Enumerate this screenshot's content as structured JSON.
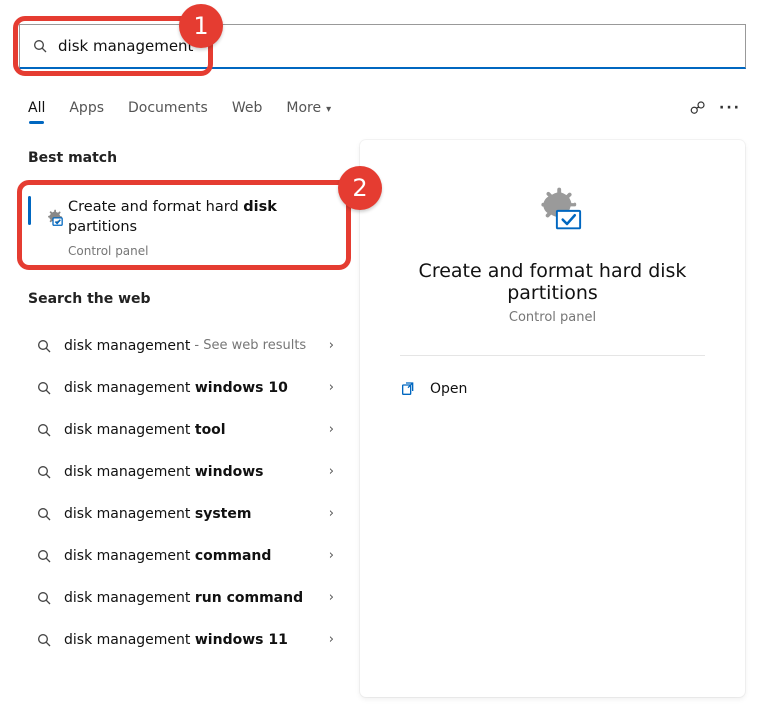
{
  "search": {
    "value": "disk management"
  },
  "tabs": {
    "all": "All",
    "apps": "Apps",
    "documents": "Documents",
    "web": "Web",
    "more": "More"
  },
  "sections": {
    "best_match": "Best match",
    "search_web": "Search the web"
  },
  "best_match": {
    "title_pre": "Create and format hard ",
    "title_bold": "disk",
    "title_post2": "partitions",
    "subtitle": "Control panel"
  },
  "web_suggestions": [
    {
      "pre": "disk management",
      "bold": "",
      "suffix": " - See web results"
    },
    {
      "pre": "disk management ",
      "bold": "windows 10",
      "suffix": ""
    },
    {
      "pre": "disk management ",
      "bold": "tool",
      "suffix": ""
    },
    {
      "pre": "disk management ",
      "bold": "windows",
      "suffix": ""
    },
    {
      "pre": "disk management ",
      "bold": "system",
      "suffix": ""
    },
    {
      "pre": "disk management ",
      "bold": "command",
      "suffix": ""
    },
    {
      "pre": "disk management ",
      "bold": "run command",
      "suffix": ""
    },
    {
      "pre": "disk management ",
      "bold": "windows 11",
      "suffix": ""
    }
  ],
  "preview": {
    "title": "Create and format hard disk partitions",
    "subtitle": "Control panel",
    "action_open": "Open"
  },
  "callouts": {
    "one": "1",
    "two": "2"
  }
}
